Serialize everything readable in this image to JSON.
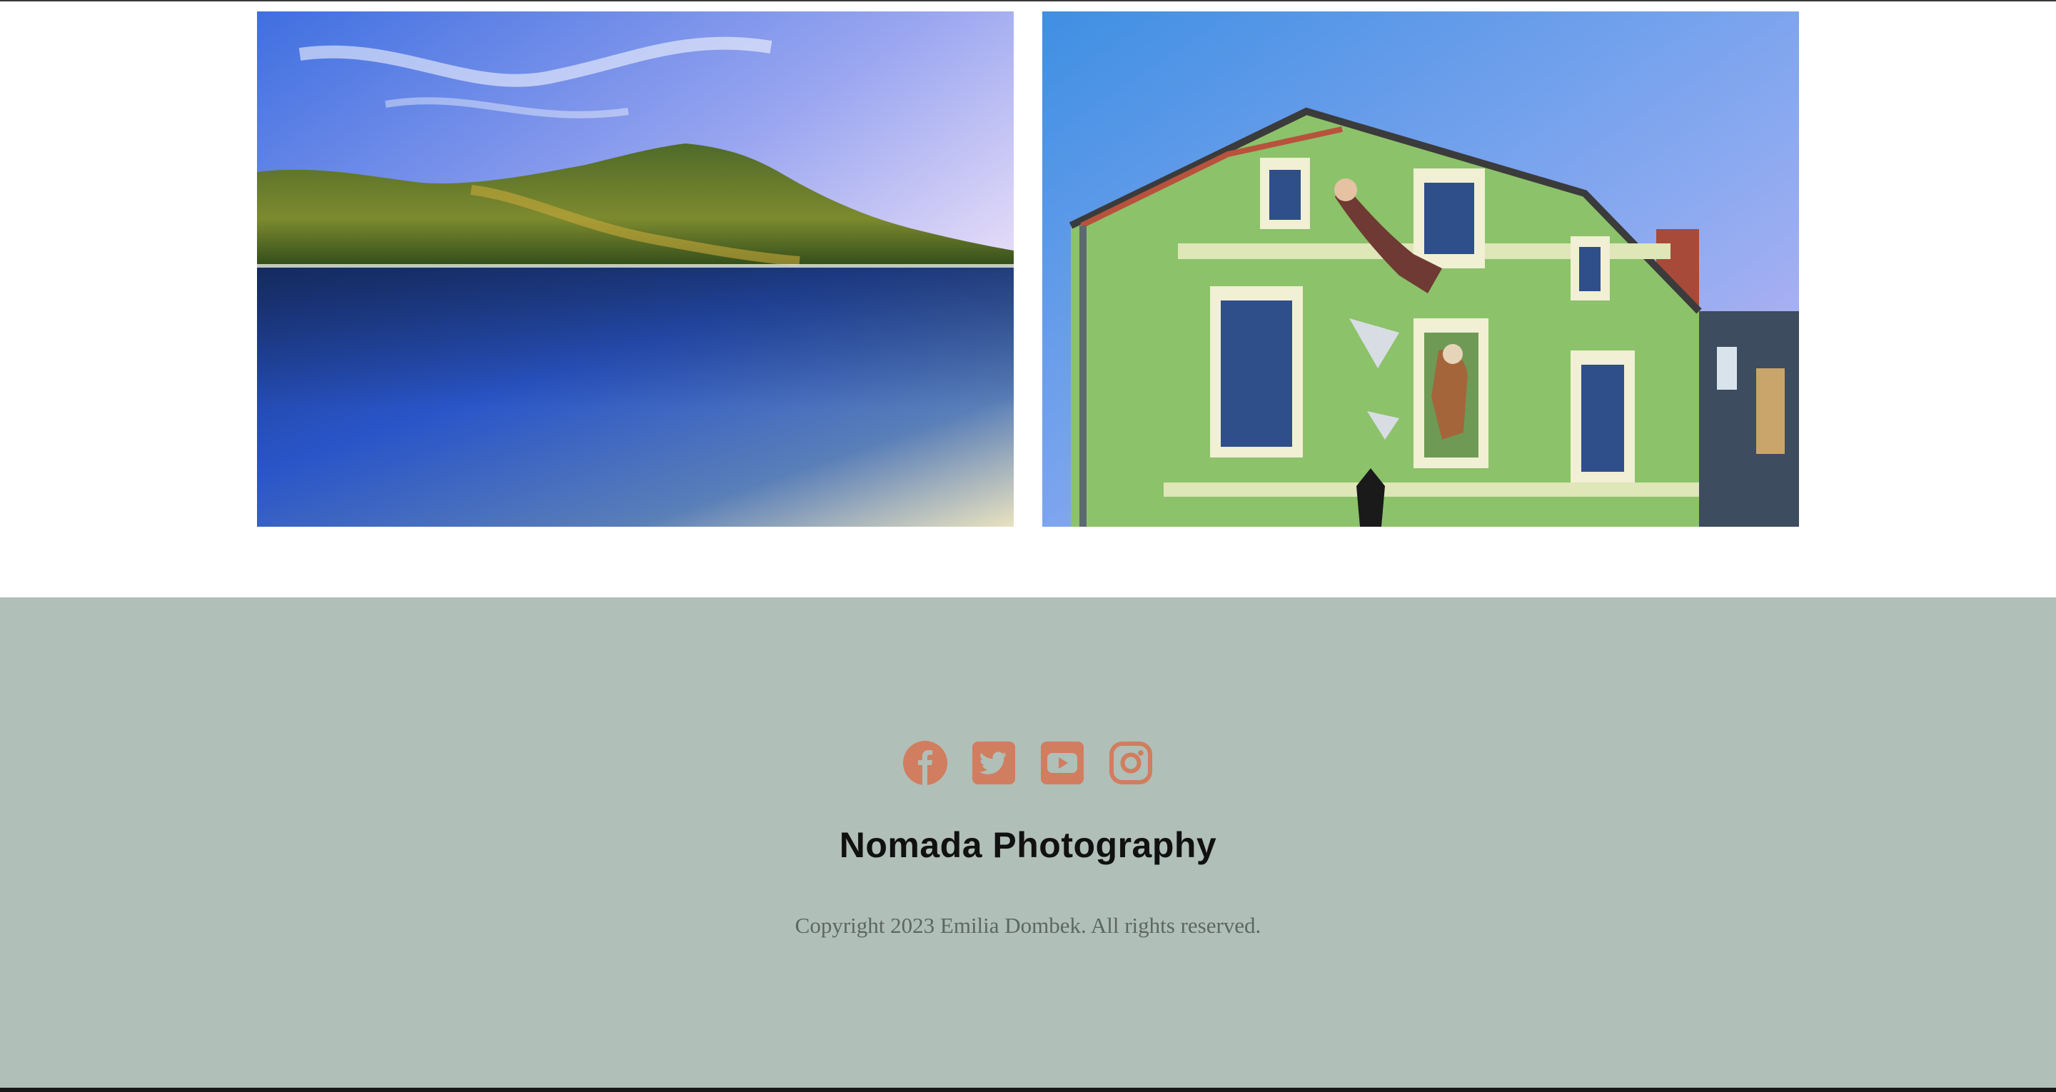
{
  "gallery": {
    "photos": [
      {
        "subject": "mountain lake landscape"
      },
      {
        "subject": "green building with mural"
      }
    ]
  },
  "footer": {
    "social": [
      {
        "icon": "facebook-icon",
        "label": "Facebook"
      },
      {
        "icon": "twitter-icon",
        "label": "Twitter"
      },
      {
        "icon": "youtube-icon",
        "label": "YouTube"
      },
      {
        "icon": "instagram-icon",
        "label": "Instagram"
      }
    ],
    "brand": "Nomada Photography",
    "copyright": "Copyright 2023 Emilia Dombek. All rights reserved."
  },
  "colors": {
    "footer_bg": "#b0bfb8",
    "social_icon": "#d17d5f",
    "brand_text": "#111111",
    "copyright_text": "#5d6762"
  }
}
